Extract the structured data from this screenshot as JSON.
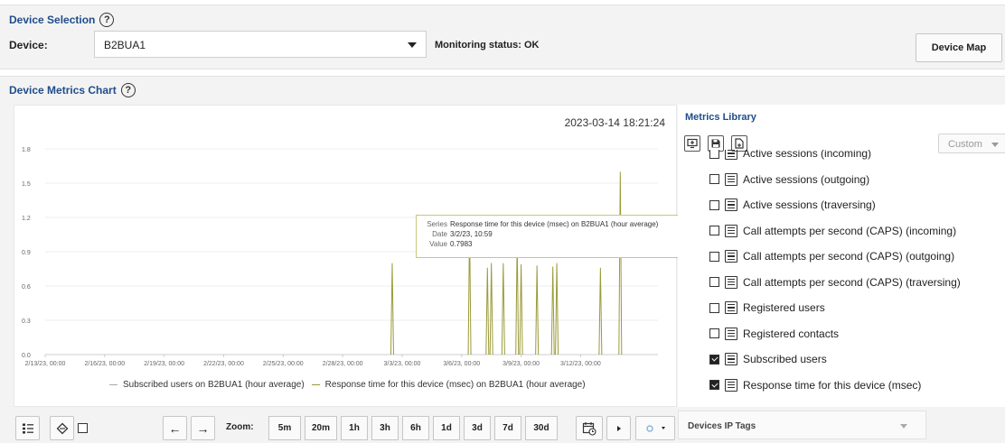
{
  "device_selection": {
    "title": "Device Selection",
    "help_icon": "?",
    "device_label": "Device:",
    "device_value": "B2BUA1",
    "monitoring_status": "Monitoring status: OK",
    "device_map_button": "Device Map"
  },
  "metrics_chart": {
    "title": "Device Metrics Chart",
    "help_icon": "?",
    "timestamp": "2023-03-14 18:21:24",
    "tooltip": {
      "series_label": "Series",
      "series_value": "Response time for this device (msec) on B2BUA1 (hour average)",
      "date_label": "Date",
      "date_value": "3/2/23, 10:59",
      "value_label": "Value",
      "value_value": "0.7983"
    },
    "legend": [
      "Subscribed users on B2BUA1 (hour average)",
      "Response time for this device (msec) on B2BUA1 (hour average)"
    ]
  },
  "chart_data": {
    "type": "line",
    "x_tick_labels": [
      "2/13/23, 00:00",
      "2/16/23, 00:00",
      "2/19/23, 00:00",
      "2/22/23, 00:00",
      "2/25/23, 00:00",
      "2/28/23, 00:00",
      "3/3/23, 00:00",
      "3/6/23, 00:00",
      "3/9/23, 00:00",
      "3/12/23, 00:00"
    ],
    "y_tick_labels": [
      "0.0",
      "0.3",
      "0.6",
      "0.9",
      "1.2",
      "1.5",
      "1.8"
    ],
    "ylim": [
      0,
      1.8
    ],
    "xlim_days": [
      0,
      30.9
    ],
    "series": [
      {
        "name": "Subscribed users on B2BUA1 (hour average)",
        "color": "#a8a8a8",
        "points": []
      },
      {
        "name": "Response time for this device (msec) on B2BUA1 (hour average)",
        "color": "#9a9a3a",
        "points": [
          [
            17.5,
            0.8
          ],
          [
            21.4,
            1.13
          ],
          [
            22.3,
            0.76
          ],
          [
            22.5,
            0.8
          ],
          [
            23.1,
            0.8
          ],
          [
            23.8,
            1.0
          ],
          [
            24.0,
            0.79
          ],
          [
            24.8,
            0.78
          ],
          [
            25.6,
            0.77
          ],
          [
            25.8,
            0.8
          ],
          [
            28.0,
            0.76
          ],
          [
            29.0,
            1.6
          ]
        ]
      }
    ],
    "grid": true
  },
  "metrics_library": {
    "title": "Metrics Library",
    "custom_select": "Custom",
    "items": [
      {
        "label": "Active sessions (incoming)",
        "checked": false
      },
      {
        "label": "Active sessions (outgoing)",
        "checked": false
      },
      {
        "label": "Active sessions (traversing)",
        "checked": false
      },
      {
        "label": "Call attempts per second (CAPS) (incoming)",
        "checked": false
      },
      {
        "label": "Call attempts per second (CAPS) (outgoing)",
        "checked": false
      },
      {
        "label": "Call attempts per second (CAPS) (traversing)",
        "checked": false
      },
      {
        "label": "Registered users",
        "checked": false
      },
      {
        "label": "Registered contacts",
        "checked": false
      },
      {
        "label": "Subscribed users",
        "checked": true
      },
      {
        "label": "Response time for this device (msec)",
        "checked": true
      }
    ]
  },
  "toolbar": {
    "zoom_label": "Zoom:",
    "zoom_options": [
      "5m",
      "20m",
      "1h",
      "3h",
      "6h",
      "1d",
      "3d",
      "7d",
      "30d"
    ],
    "prev_arrow": "←",
    "next_arrow": "→",
    "devices_ip_tags": "Devices IP Tags"
  }
}
